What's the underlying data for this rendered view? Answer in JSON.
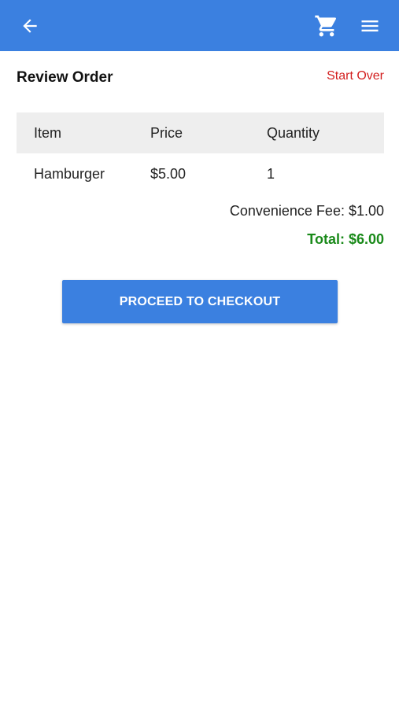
{
  "app_bar": {
    "back_icon": "arrow-left-icon",
    "cart_icon": "shopping-cart-icon",
    "menu_icon": "hamburger-menu-icon",
    "background": "#3b80e0"
  },
  "header": {
    "title": "Review Order",
    "start_over": "Start Over"
  },
  "table": {
    "columns": [
      "Item",
      "Price",
      "Quantity"
    ],
    "rows": [
      {
        "item": "Hamburger",
        "price": "$5.00",
        "quantity": "1"
      }
    ]
  },
  "summary": {
    "fee": "Convenience Fee: $1.00",
    "total": "Total: $6.00"
  },
  "checkout_label": "PROCEED TO CHECKOUT",
  "colors": {
    "accent": "#3b80e0",
    "danger": "#d32020",
    "success": "#1a8a1a"
  }
}
